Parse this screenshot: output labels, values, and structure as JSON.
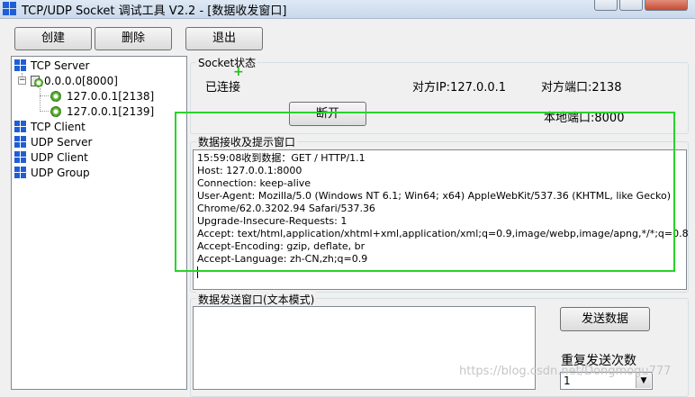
{
  "window": {
    "title": "TCP/UDP Socket 调试工具 V2.2 - [数据收发窗口]"
  },
  "toolbar": {
    "create_label": "创建",
    "delete_label": "删除",
    "exit_label": "退出"
  },
  "tree": {
    "tcp_server": "TCP Server",
    "server_node": "0.0.0.0[8000]",
    "conn1": "127.0.0.1[2138]",
    "conn2": "127.0.0.1[2139]",
    "tcp_client": "TCP Client",
    "udp_server": "UDP Server",
    "udp_client": "UDP Client",
    "udp_group": "UDP Group"
  },
  "socket_status": {
    "group_label": "Socket状态",
    "state": "已连接",
    "remote_ip": "对方IP:127.0.0.1",
    "remote_port": "对方端口:2138",
    "disconnect_label": "断开",
    "local_port": "本地端口:8000"
  },
  "receive": {
    "group_label": "数据接收及提示窗口",
    "lines": [
      "15:59:08收到数据：GET / HTTP/1.1",
      "Host: 127.0.0.1:8000",
      "Connection: keep-alive",
      "User-Agent: Mozilla/5.0 (Windows NT 6.1; Win64; x64) AppleWebKit/537.36 (KHTML, like Gecko)",
      "Chrome/62.0.3202.94 Safari/537.36",
      "Upgrade-Insecure-Requests: 1",
      "Accept: text/html,application/xhtml+xml,application/xml;q=0.9,image/webp,image/apng,*/*;q=0.8",
      "Accept-Encoding: gzip, deflate, br",
      "Accept-Language: zh-CN,zh;q=0.9"
    ]
  },
  "send": {
    "group_label": "数据发送窗口(文本模式)",
    "send_button": "发送数据",
    "repeat_label": "重复发送次数",
    "repeat_value": "1"
  },
  "watermark": "https://blog.csdn.net/Dongmogu777",
  "colors": {
    "highlight": "#29d329",
    "tree_icon_blue": "#1f5fd6",
    "gear_green": "#4caf2f"
  }
}
